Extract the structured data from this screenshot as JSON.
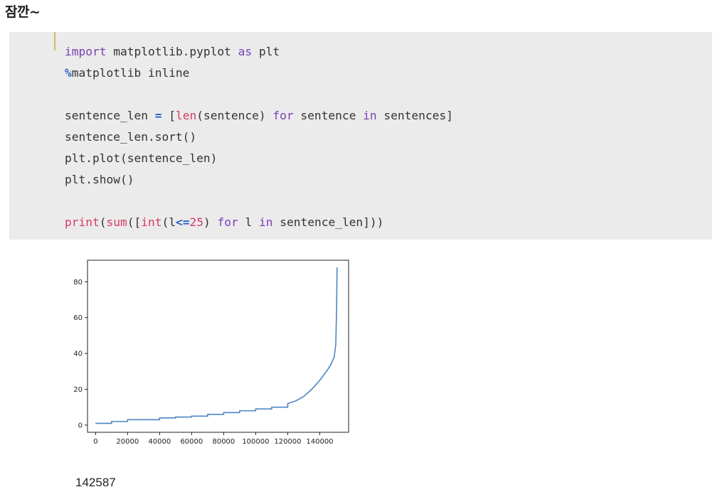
{
  "heading": "잠깐~",
  "code": {
    "line1": {
      "import_kw": "import",
      "module": " matplotlib.pyplot ",
      "as_kw": "as",
      "alias": " plt"
    },
    "line2": {
      "percent": "%",
      "magic": "matplotlib inline"
    },
    "line3": {
      "var": "sentence_len ",
      "eq": "=",
      "open": " [",
      "len_fn": "len",
      "arg": "(sentence) ",
      "for_kw": "for",
      "loopvar": " sentence ",
      "in_kw": "in",
      "iter": " sentences]"
    },
    "line4": "sentence_len.sort()",
    "line5": "plt.plot(sentence_len)",
    "line6": "plt.show()",
    "line7": {
      "print_fn": "print",
      "p1": "(",
      "sum_fn": "sum",
      "p2": "([",
      "int_fn": "int",
      "p3": "(l",
      "le": "<=",
      "num": "25",
      "p4": ") ",
      "for_kw": "for",
      "loopvar": " l ",
      "in_kw": "in",
      "iter": " sentence_len]))"
    }
  },
  "chart_data": {
    "type": "line",
    "x": [
      0,
      10000,
      20000,
      30000,
      40000,
      50000,
      60000,
      70000,
      80000,
      90000,
      100000,
      110000,
      120000,
      125000,
      130000,
      135000,
      140000,
      145000,
      147000,
      149000,
      150000,
      150500,
      150800
    ],
    "y": [
      1,
      2,
      3,
      3,
      4,
      4.5,
      5,
      6,
      7,
      8,
      9,
      10,
      12,
      13.5,
      16,
      20,
      25,
      31,
      34,
      38,
      45,
      65,
      88
    ],
    "xlim": [
      -5000,
      158000
    ],
    "ylim": [
      -4,
      92
    ],
    "xticks": [
      0,
      20000,
      40000,
      60000,
      80000,
      100000,
      120000,
      140000
    ],
    "yticks": [
      0,
      20,
      40,
      60,
      80
    ],
    "line_color": "#4e86c4"
  },
  "output": "142587"
}
